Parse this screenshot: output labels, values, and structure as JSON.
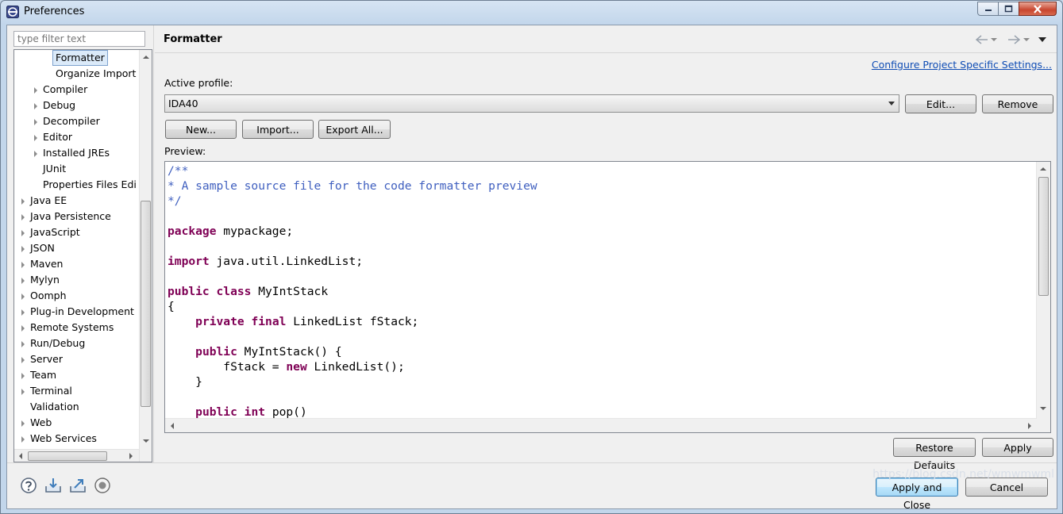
{
  "window": {
    "title": "Preferences"
  },
  "filter": {
    "placeholder": "type filter text"
  },
  "tree": {
    "items": [
      {
        "label": "Formatter",
        "expandable": false,
        "selected": true
      },
      {
        "label": "Organize Import",
        "expandable": false
      },
      {
        "label": "Compiler",
        "expandable": true
      },
      {
        "label": "Debug",
        "expandable": true
      },
      {
        "label": "Decompiler",
        "expandable": true
      },
      {
        "label": "Editor",
        "expandable": true
      },
      {
        "label": "Installed JREs",
        "expandable": true
      },
      {
        "label": "JUnit",
        "expandable": false
      },
      {
        "label": "Properties Files Edi",
        "expandable": false
      },
      {
        "label": "Java EE",
        "expandable": true
      },
      {
        "label": "Java Persistence",
        "expandable": true
      },
      {
        "label": "JavaScript",
        "expandable": true
      },
      {
        "label": "JSON",
        "expandable": true
      },
      {
        "label": "Maven",
        "expandable": true
      },
      {
        "label": "Mylyn",
        "expandable": true
      },
      {
        "label": "Oomph",
        "expandable": true
      },
      {
        "label": "Plug-in Development",
        "expandable": true
      },
      {
        "label": "Remote Systems",
        "expandable": true
      },
      {
        "label": "Run/Debug",
        "expandable": true
      },
      {
        "label": "Server",
        "expandable": true
      },
      {
        "label": "Team",
        "expandable": true
      },
      {
        "label": "Terminal",
        "expandable": true
      },
      {
        "label": "Validation",
        "expandable": false
      },
      {
        "label": "Web",
        "expandable": true
      },
      {
        "label": "Web Services",
        "expandable": true
      }
    ]
  },
  "page": {
    "title": "Formatter",
    "configure_link": "Configure Project Specific Settings...",
    "active_profile_label": "Active profile:",
    "active_profile_value": "IDA40",
    "edit_button": "Edit...",
    "remove_button": "Remove",
    "new_button": "New...",
    "import_button": "Import...",
    "export_button": "Export All...",
    "preview_label": "Preview:",
    "restore_defaults_button": "Restore Defaults",
    "apply_button": "Apply"
  },
  "preview_code": [
    [
      {
        "t": "/**",
        "c": "cm"
      }
    ],
    [
      {
        "t": "* A sample source file for the code formatter preview",
        "c": "cm"
      }
    ],
    [
      {
        "t": "*/",
        "c": "cm"
      }
    ],
    [],
    [
      {
        "t": "package",
        "c": "kw"
      },
      {
        "t": " mypackage;"
      }
    ],
    [],
    [
      {
        "t": "import",
        "c": "kw"
      },
      {
        "t": " java.util.LinkedList;"
      }
    ],
    [],
    [
      {
        "t": "public",
        "c": "kw"
      },
      {
        "t": " "
      },
      {
        "t": "class",
        "c": "kw"
      },
      {
        "t": " MyIntStack"
      }
    ],
    [
      {
        "t": "{"
      }
    ],
    [
      {
        "t": "    "
      },
      {
        "t": "private",
        "c": "kw"
      },
      {
        "t": " "
      },
      {
        "t": "final",
        "c": "kw"
      },
      {
        "t": " LinkedList fStack;"
      }
    ],
    [],
    [
      {
        "t": "    "
      },
      {
        "t": "public",
        "c": "kw"
      },
      {
        "t": " MyIntStack() {"
      }
    ],
    [
      {
        "t": "        fStack = "
      },
      {
        "t": "new",
        "c": "kw"
      },
      {
        "t": " LinkedList();"
      }
    ],
    [
      {
        "t": "    }"
      }
    ],
    [],
    [
      {
        "t": "    "
      },
      {
        "t": "public",
        "c": "kw"
      },
      {
        "t": " "
      },
      {
        "t": "int",
        "c": "kw"
      },
      {
        "t": " pop()"
      }
    ]
  ],
  "footer": {
    "icons": [
      "help-icon",
      "import-icon",
      "export-icon",
      "record-icon"
    ],
    "apply_close_button": "Apply and Close",
    "cancel_button": "Cancel"
  },
  "watermark": "https://blog.csdn.net/wmwmwml"
}
